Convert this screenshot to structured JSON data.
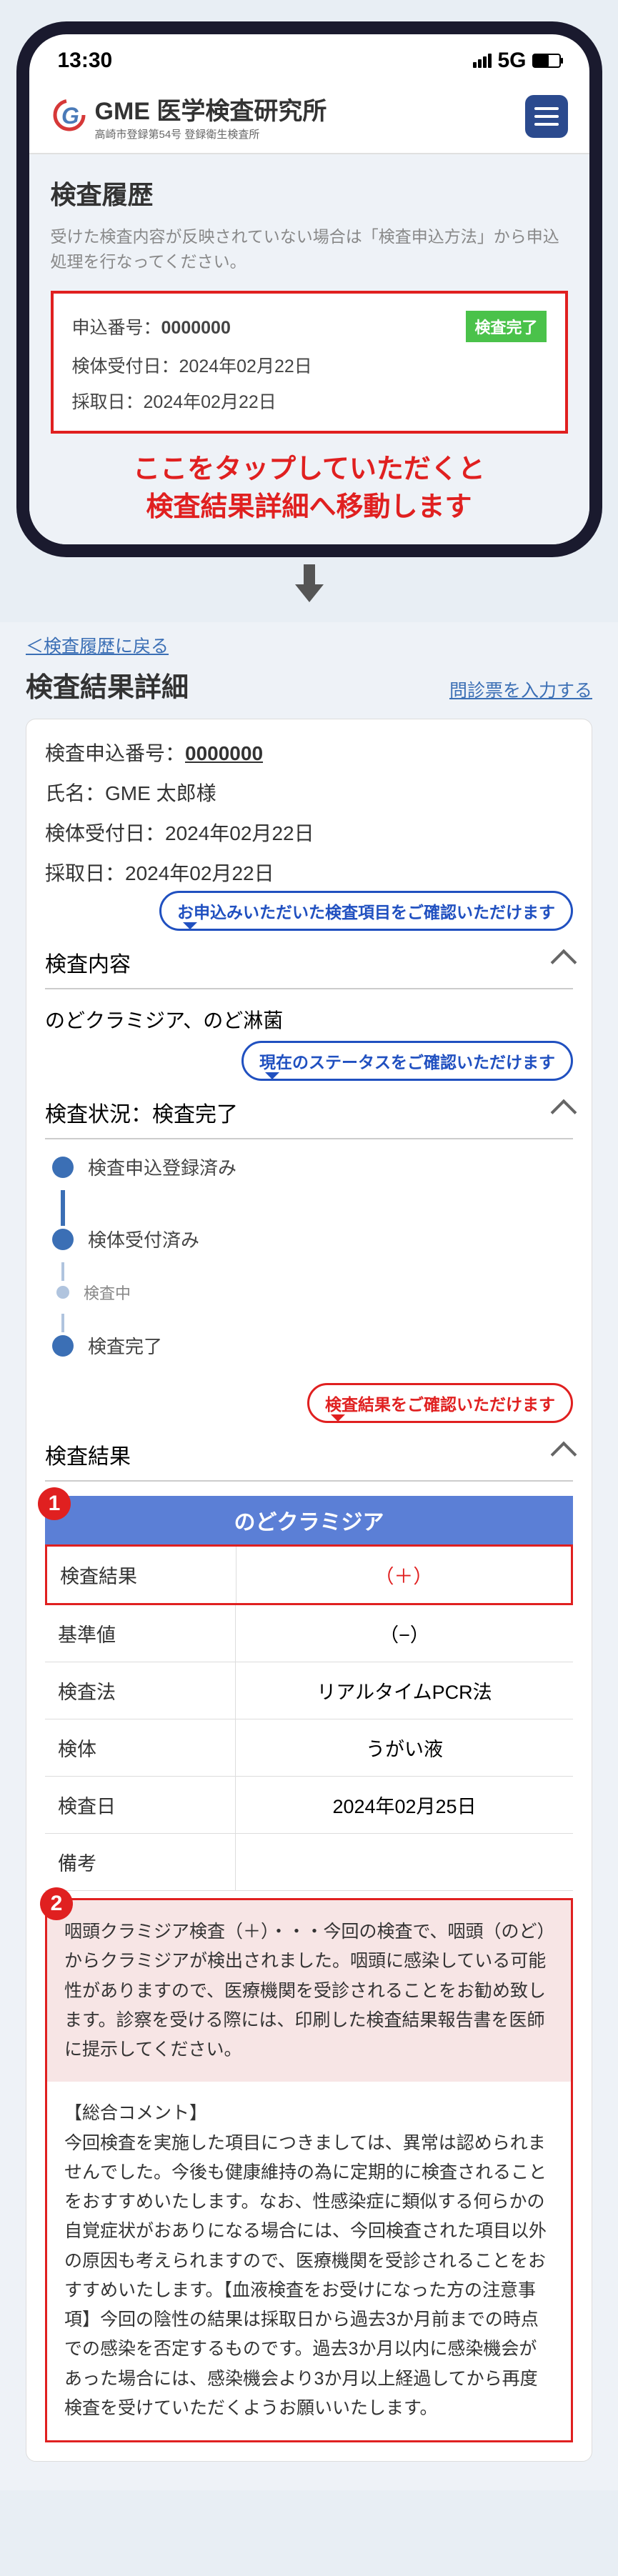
{
  "status_bar": {
    "time": "13:30",
    "network": "5G"
  },
  "header": {
    "brand_top": "GME 医学検査研究所",
    "brand_sub": "高崎市登録第54号 登録衛生検査所"
  },
  "history": {
    "title": "検査履歴",
    "note": "受けた検査内容が反映されていない場合は「検査申込方法」から申込処理を行なってください。",
    "app_no_label": "申込番号：",
    "app_no": "0000000",
    "badge": "検査完了",
    "receipt_label": "検体受付日：",
    "receipt": "2024年02月22日",
    "collect_label": "採取日：",
    "collect": "2024年02月22日"
  },
  "instruction": "ここをタップしていただくと\n検査結果詳細へ移動します",
  "back_link": "＜検査履歴に戻る",
  "detail": {
    "title": "検査結果詳細",
    "entry_link": "問診票を入力する",
    "app_label": "検査申込番号：",
    "app_no": "0000000",
    "name_label": "氏名：",
    "name": "GME 太郎様",
    "receipt_label": "検体受付日：",
    "receipt": "2024年02月22日",
    "collect_label": "採取日：",
    "collect": "2024年02月22日"
  },
  "speeches": {
    "items": "お申込みいただいた検査項目をご確認いただけます",
    "status": "現在のステータスをご確認いただけます",
    "result": "検査結果をご確認いただけます"
  },
  "sections": {
    "content": "検査内容",
    "throat": "のどクラミジア、のど淋菌",
    "status_label": "検査状況：",
    "status_value": "検査完了",
    "result": "検査結果"
  },
  "timeline": {
    "s1": "検査申込登録済み",
    "s2": "検体受付済み",
    "s3": "検査中",
    "s4": "検査完了"
  },
  "result": {
    "header": "のどクラミジア",
    "rows": [
      {
        "label": "検査結果",
        "value": "（＋）",
        "red": true
      },
      {
        "label": "基準値",
        "value": "（−）"
      },
      {
        "label": "検査法",
        "value": "リアルタイムPCR法"
      },
      {
        "label": "検体",
        "value": "うがい液"
      },
      {
        "label": "検査日",
        "value": "2024年02月25日"
      },
      {
        "label": "備考",
        "value": ""
      }
    ]
  },
  "comment": {
    "top": "咽頭クラミジア検査（＋）・・・今回の検査で、咽頭（のど）からクラミジアが検出されました。咽頭に感染している可能性がありますので、医療機関を受診されることをお勧め致します。診察を受ける際には、印刷した検査結果報告書を医師に提示してください。",
    "bottom_title": "【総合コメント】",
    "bottom": "今回検査を実施した項目につきましては、異常は認められませんでした。今後も健康維持の為に定期的に検査されることをおすすめいたします。なお、性感染症に類似する何らかの自覚症状がおありになる場合には、今回検査された項目以外の原因も考えられますので、医療機関を受診されることをおすすめいたします。【血液検査をお受けになった方の注意事項】今回の陰性の結果は採取日から過去3か月前までの時点での感染を否定するものです。過去3か月以内に感染機会があった場合には、感染機会より3か月以上経過してから再度検査を受けていただくようお願いいたします。"
  }
}
